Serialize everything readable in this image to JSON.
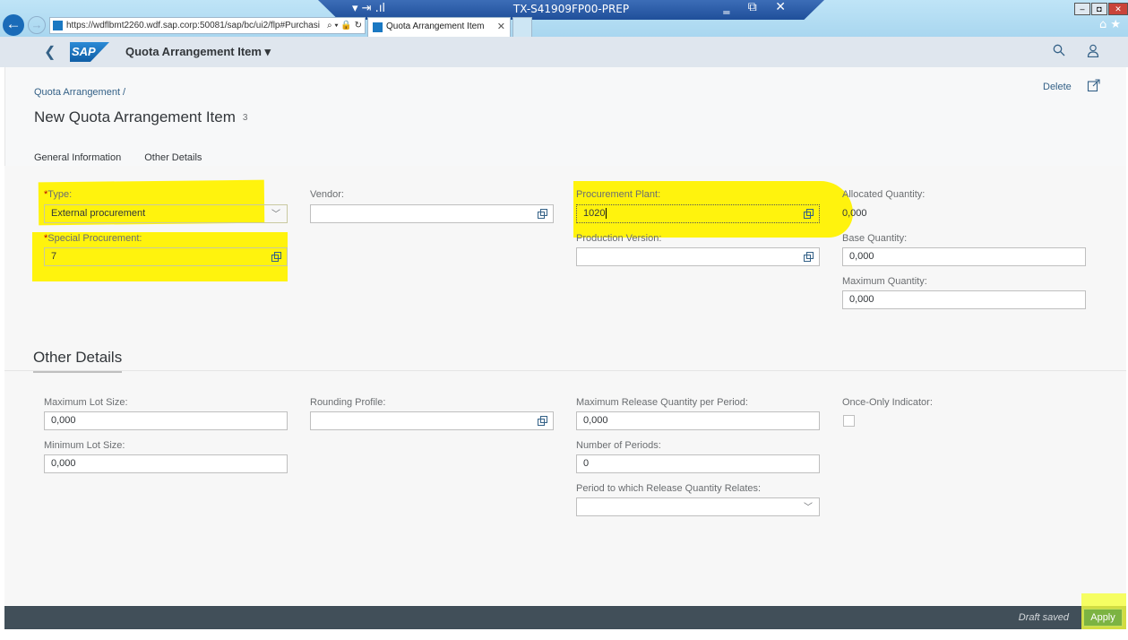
{
  "browser": {
    "remote_title": "TX-S41909FP00-PREP",
    "url": "https://wdflbmt2260.wdf.sap.corp:50081/sap/bc/ui2/flp#Purchasi",
    "tab_title": "Quota Arrangement Item"
  },
  "shell": {
    "logo_text": "SAP",
    "app_title": "Quota Arrangement Item ▾"
  },
  "header": {
    "breadcrumb": "Quota Arrangement /",
    "title": "New Quota Arrangement Item",
    "count": "3",
    "delete_label": "Delete",
    "tabs": [
      {
        "label": "General Information"
      },
      {
        "label": "Other Details"
      }
    ]
  },
  "general": {
    "type": {
      "label": "Type:",
      "value": "External procurement"
    },
    "special_procurement": {
      "label": "Special Procurement:",
      "value": "7"
    },
    "vendor": {
      "label": "Vendor:",
      "value": ""
    },
    "procurement_plant": {
      "label": "Procurement Plant:",
      "value": "1020"
    },
    "production_version": {
      "label": "Production Version:",
      "value": ""
    },
    "allocated_quantity": {
      "label": "Allocated Quantity:",
      "value": "0,000"
    },
    "base_quantity": {
      "label": "Base Quantity:",
      "value": "0,000"
    },
    "maximum_quantity": {
      "label": "Maximum Quantity:",
      "value": "0,000"
    }
  },
  "other": {
    "section_title": "Other Details",
    "max_lot_size": {
      "label": "Maximum Lot Size:",
      "value": "0,000"
    },
    "min_lot_size": {
      "label": "Minimum Lot Size:",
      "value": "0,000"
    },
    "rounding_profile": {
      "label": "Rounding Profile:",
      "value": ""
    },
    "max_release_qty": {
      "label": "Maximum Release Quantity per Period:",
      "value": "0,000"
    },
    "number_of_periods": {
      "label": "Number of Periods:",
      "value": "0"
    },
    "period_release": {
      "label": "Period to which Release Quantity Relates:",
      "value": ""
    },
    "once_only": {
      "label": "Once-Only Indicator:"
    }
  },
  "footer": {
    "status": "Draft saved",
    "apply_label": "Apply"
  },
  "colors": {
    "highlight": "#fff200",
    "link": "#346187",
    "footer": "#414f59",
    "apply": "#7cb342"
  }
}
